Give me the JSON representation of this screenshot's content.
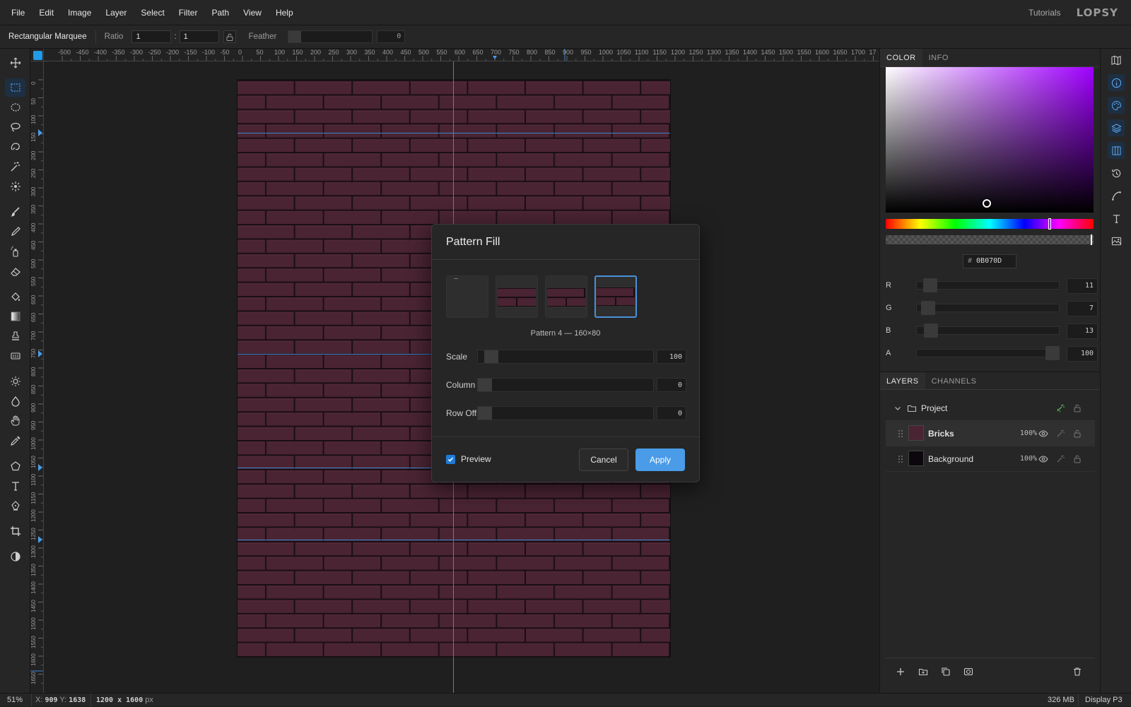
{
  "menu": {
    "items": [
      "File",
      "Edit",
      "Image",
      "Layer",
      "Select",
      "Filter",
      "Path",
      "View",
      "Help"
    ],
    "tutorials": "Tutorials",
    "logo": "LOPSY"
  },
  "options": {
    "tool_name": "Rectangular Marquee",
    "ratio_label": "Ratio",
    "ratio_w": "1",
    "ratio_sep": ":",
    "ratio_h": "1",
    "feather_label": "Feather",
    "feather_value": "0"
  },
  "tools": [
    {
      "name": "move-tool",
      "icon": "move-icon",
      "active": false
    },
    {
      "name": "rect-marquee-tool",
      "icon": "rect-marquee-icon",
      "active": true
    },
    {
      "name": "ellipse-marquee-tool",
      "icon": "ellipse-marquee-icon",
      "active": false
    },
    {
      "name": "lasso-tool",
      "icon": "lasso-icon",
      "active": false
    },
    {
      "name": "magnetic-lasso-tool",
      "icon": "magnetic-lasso-icon",
      "active": false
    },
    {
      "name": "magic-wand-tool",
      "icon": "magic-wand-icon",
      "active": false
    },
    {
      "name": "quick-select-tool",
      "icon": "quick-select-icon",
      "active": false
    },
    {
      "name": "brush-tool",
      "icon": "brush-icon",
      "active": false
    },
    {
      "name": "pencil-tool",
      "icon": "pencil-icon",
      "active": false
    },
    {
      "name": "spray-tool",
      "icon": "spray-icon",
      "active": false
    },
    {
      "name": "eraser-tool",
      "icon": "eraser-icon",
      "active": false
    },
    {
      "name": "paint-bucket-tool",
      "icon": "paint-bucket-icon",
      "active": false
    },
    {
      "name": "gradient-tool",
      "icon": "gradient-icon",
      "active": false
    },
    {
      "name": "clone-stamp-tool",
      "icon": "clone-stamp-icon",
      "active": false
    },
    {
      "name": "pattern-stamp-tool",
      "icon": "pattern-stamp-icon",
      "active": false
    },
    {
      "name": "dodge-tool",
      "icon": "sun-icon",
      "active": false
    },
    {
      "name": "burn-tool",
      "icon": "drop-icon",
      "active": false
    },
    {
      "name": "hand-tool",
      "icon": "hand-icon",
      "active": false
    },
    {
      "name": "eyedropper-tool",
      "icon": "eyedropper-icon",
      "active": false
    },
    {
      "name": "shape-tool",
      "icon": "pentagon-icon",
      "active": false
    },
    {
      "name": "text-tool",
      "icon": "text-icon",
      "active": false
    },
    {
      "name": "pen-tool",
      "icon": "pen-icon",
      "active": false
    },
    {
      "name": "crop-tool",
      "icon": "crop-icon",
      "active": false
    },
    {
      "name": "color-mode-toggle",
      "icon": "contrast-icon",
      "active": false
    }
  ],
  "ruler": {
    "top_labels": [
      "-500",
      "-450",
      "-400",
      "-350",
      "-300",
      "-250",
      "-200",
      "-150",
      "-100",
      "-50",
      "0",
      "50",
      "100",
      "150",
      "200",
      "250",
      "300",
      "350",
      "400",
      "450",
      "500",
      "550",
      "600",
      "650",
      "700",
      "750",
      "800",
      "850",
      "900",
      "950",
      "1000",
      "1050",
      "1100",
      "1150",
      "1200",
      "1250",
      "1300",
      "1350",
      "1400",
      "1450",
      "1500",
      "1550",
      "1600",
      "1650",
      "1700",
      "17"
    ],
    "left_labels": [
      "0",
      "50",
      "100",
      "150",
      "200",
      "250",
      "300",
      "350",
      "400",
      "450",
      "500",
      "550",
      "600",
      "650",
      "700",
      "750",
      "800",
      "850",
      "900",
      "950",
      "1000",
      "1050",
      "1100",
      "1150",
      "1200",
      "1250",
      "1300",
      "1350",
      "1400",
      "1450",
      "1500",
      "1550",
      "1600",
      "1650"
    ]
  },
  "dialog": {
    "title": "Pattern Fill",
    "caption": "Pattern 4 — 160×80",
    "sliders": [
      {
        "label": "Scale",
        "value": "100",
        "level": 0.04
      },
      {
        "label": "Column Offset",
        "value": "0",
        "level": 0.0
      },
      {
        "label": "Row Offset",
        "value": "0",
        "level": 0.0
      }
    ],
    "preview_label": "Preview",
    "preview_checked": true,
    "cancel": "Cancel",
    "apply": "Apply",
    "selected_pattern": 4
  },
  "color_panel": {
    "tabs": [
      "COLOR",
      "INFO"
    ],
    "hex_prefix": "#",
    "hex": "0B070D",
    "channels": [
      {
        "label": "R",
        "value": "11"
      },
      {
        "label": "G",
        "value": "7"
      },
      {
        "label": "B",
        "value": "13"
      },
      {
        "label": "A",
        "value": "100"
      }
    ]
  },
  "layers_panel": {
    "tabs": [
      "LAYERS",
      "CHANNELS"
    ],
    "group": "Project",
    "layers": [
      {
        "name": "Bricks",
        "opacity": "100%",
        "selected": true
      },
      {
        "name": "Background",
        "opacity": "100%",
        "selected": false
      }
    ]
  },
  "side_icons": [
    "map-icon",
    "info-icon",
    "palette-icon",
    "layers-icon",
    "channels-icon",
    "history-icon",
    "curve-icon",
    "text-icon",
    "image-adjust-icon"
  ],
  "status": {
    "zoom": "51%",
    "x_label": "X:",
    "x": "909",
    "y_label": "Y:",
    "y": "1638",
    "size": "1200 x 1600",
    "size_unit": "px",
    "memory": "326 MB",
    "profile": "Display P3"
  },
  "colors": {
    "accent": "#4a9be8",
    "brick": "#4a2433",
    "mortar": "#1a0e14",
    "guide": "#3d86d0"
  }
}
